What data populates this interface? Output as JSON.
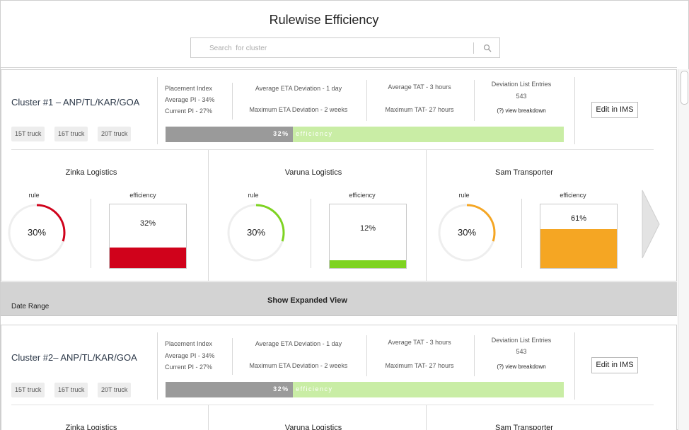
{
  "page": {
    "title": "Rulewise Efficiency"
  },
  "search": {
    "placeholder": "Search  for cluster"
  },
  "clusters": [
    {
      "name": "Cluster #1 – ANP/TL/KAR/GOA",
      "tags": [
        "15T truck",
        "16T truck",
        "20T truck"
      ],
      "placement": {
        "title": "Placement Index",
        "average": "Average PI - 34%",
        "current": "Current PI - 27%"
      },
      "eta": {
        "average": "Average ETA Deviation - 1 day",
        "maximum": "Maximum ETA Deviation - 2 weeks"
      },
      "tat": {
        "average": "Average TAT - 3 hours",
        "maximum": "Maximum TAT- 27 hours"
      },
      "deviation": {
        "title": "Deviation List Entries",
        "count": "543",
        "link": "(?) view breakdown"
      },
      "efficiency": {
        "value": 0.32,
        "pct_label": "32%",
        "label": "efficiency"
      },
      "edit_label": "Edit in IMS",
      "logistics": [
        {
          "name": "Zinka Logistics",
          "rule_label": "rule",
          "eff_label": "efficiency",
          "rule_value": 0.3,
          "rule_text": "30%",
          "eff_value": 0.32,
          "eff_text": "32%",
          "color": "#d0021b"
        },
        {
          "name": "Varuna Logistics",
          "rule_label": "rule",
          "eff_label": "efficiency",
          "rule_value": 0.3,
          "rule_text": "30%",
          "eff_value": 0.12,
          "eff_text": "12%",
          "color": "#7ed321"
        },
        {
          "name": "Sam Transporter",
          "rule_label": "rule",
          "eff_label": "efficiency",
          "rule_value": 0.3,
          "rule_text": "30%",
          "eff_value": 0.61,
          "eff_text": "61%",
          "color": "#f5a623"
        }
      ]
    },
    {
      "name": "Cluster #2– ANP/TL/KAR/GOA",
      "tags": [
        "15T truck",
        "16T truck",
        "20T truck"
      ],
      "placement": {
        "title": "Placement Index",
        "average": "Average PI - 34%",
        "current": "Current PI - 27%"
      },
      "eta": {
        "average": "Average ETA Deviation - 1 day",
        "maximum": "Maximum ETA Deviation - 2 weeks"
      },
      "tat": {
        "average": "Average TAT - 3 hours",
        "maximum": "Maximum TAT- 27 hours"
      },
      "deviation": {
        "title": "Deviation List Entries",
        "count": "543",
        "link": "(?) view breakdown"
      },
      "efficiency": {
        "value": 0.32,
        "pct_label": "32%",
        "label": "efficiency"
      },
      "edit_label": "Edit in IMS",
      "logistics": [
        {
          "name": "Zinka Logistics"
        },
        {
          "name": "Varuna Logistics"
        },
        {
          "name": "Sam Transporter"
        }
      ]
    }
  ],
  "expand": {
    "show_label": "Show Expanded View",
    "date_label": "Date Range"
  },
  "colors": {
    "bar_fill": "#9a9a9a",
    "bar_track": "#c9eda5"
  },
  "icons": {
    "search": "search-icon",
    "next": "chevron-right-icon"
  }
}
